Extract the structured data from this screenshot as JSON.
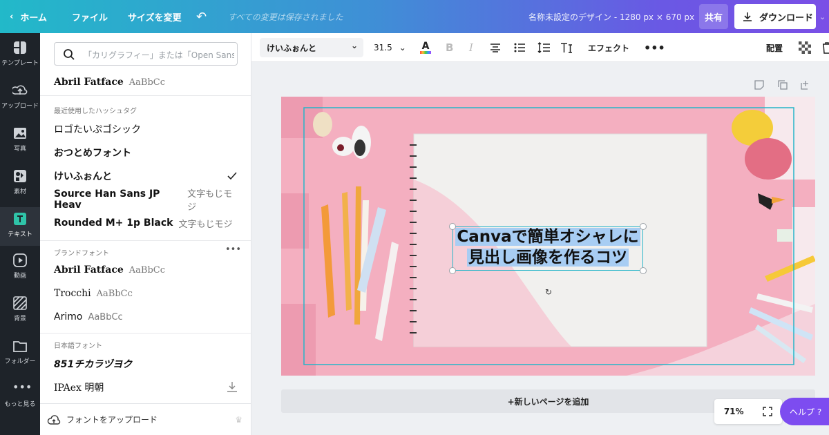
{
  "topbar": {
    "home_label": "ホーム",
    "file_label": "ファイル",
    "resize_label": "サイズを変更",
    "saved_status": "すべての変更は保存されました",
    "design_title": "名称未設定のデザイン - 1280 px × 670 px",
    "share_label": "共有",
    "download_label": "ダウンロード"
  },
  "rail": {
    "items": [
      {
        "label": "テンプレート",
        "icon": "template-icon"
      },
      {
        "label": "アップロード",
        "icon": "upload-icon"
      },
      {
        "label": "写真",
        "icon": "photo-icon"
      },
      {
        "label": "素材",
        "icon": "elements-icon"
      },
      {
        "label": "テキスト",
        "icon": "text-icon"
      },
      {
        "label": "動画",
        "icon": "video-icon"
      },
      {
        "label": "背景",
        "icon": "background-icon"
      },
      {
        "label": "フォルダー",
        "icon": "folder-icon"
      },
      {
        "label": "もっと見る",
        "icon": "more-icon"
      }
    ]
  },
  "font_panel": {
    "search_placeholder": "「カリグラフィー」または「Open Sans」で検索",
    "top_font": {
      "name": "Abril Fatface",
      "sample": "AaBbCc"
    },
    "recent_header": "最近使用したハッシュタグ",
    "recent": [
      {
        "name": "ロゴたいぷゴシック",
        "sample": ""
      },
      {
        "name": "おつとめフォント",
        "sample": ""
      },
      {
        "name": "けいふぉんと",
        "sample": "",
        "selected": true
      },
      {
        "name": "Source Han Sans JP Heav",
        "sample": "文字もじモジ"
      },
      {
        "name": "Rounded M+ 1p Black",
        "sample": "文字もじモジ"
      }
    ],
    "brand_header": "ブランドフォント",
    "brand": [
      {
        "name": "Abril Fatface",
        "sample": "AaBbCc"
      },
      {
        "name": "Trocchi",
        "sample": "AaBbCc"
      },
      {
        "name": "Arimo",
        "sample": "AaBbCc"
      }
    ],
    "japanese_header": "日本語フォント",
    "japanese": [
      {
        "name": "851チカラヅヨク",
        "sample": ""
      },
      {
        "name": "IPAex 明朝",
        "sample": ""
      }
    ],
    "upload_label": "フォントをアップロード"
  },
  "toolbar": {
    "font_name": "けいふぉんと",
    "font_size": "31.5",
    "effects_label": "エフェクト",
    "arrange_label": "配置"
  },
  "canvas": {
    "heading_line1": "Canvaで簡単オシャレに",
    "heading_line2": "見出し画像を作るコツ",
    "add_page_label": "+新しいページを追加",
    "zoom": "71%",
    "help_label": "ヘルプ ?"
  },
  "colors": {
    "accent_teal": "#22b9c9",
    "accent_purple": "#7a4fe6",
    "rail_bg": "#1e2329",
    "selection": "#25b5c8",
    "text_highlight": "#a8cdf3",
    "canvas_pink": "#f2a7ba"
  }
}
